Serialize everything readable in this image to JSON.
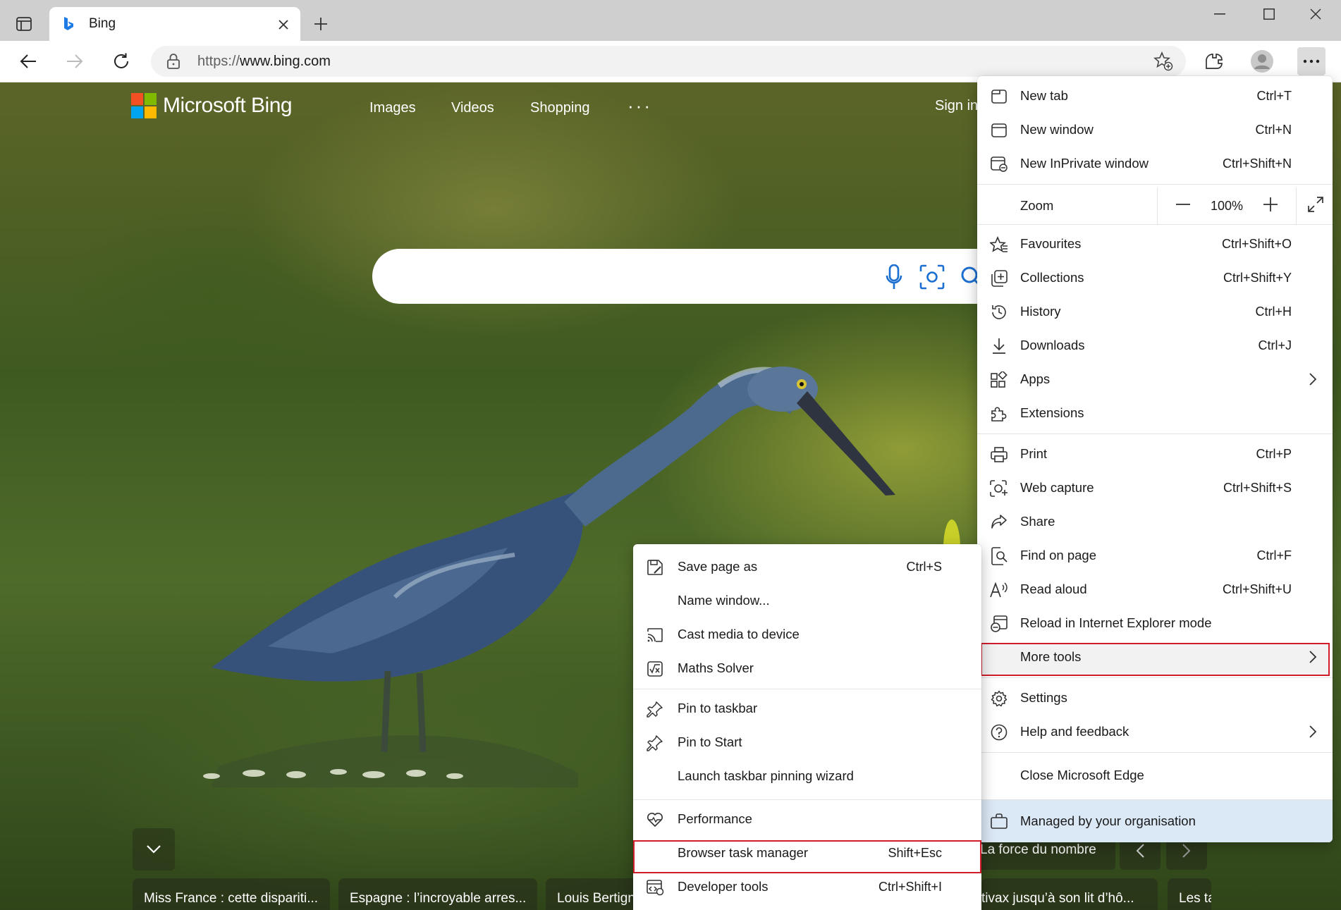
{
  "window": {
    "tab_title": "Bing",
    "controls": {
      "minimize_icon": "minimize-icon",
      "maximize_icon": "maximize-icon",
      "close_icon": "close-icon"
    }
  },
  "toolbar": {
    "url_scheme": "https://",
    "url_host": "www.bing.com"
  },
  "bing": {
    "logo_text": "Microsoft Bing",
    "nav": [
      "Images",
      "Videos",
      "Shopping"
    ],
    "more": "···",
    "sign_in": "Sign in",
    "logo_colors": [
      "#f25022",
      "#7fba00",
      "#00a4ef",
      "#ffb900"
    ],
    "news_cards": [
      "Miss France : cette dispariti...",
      "Espagne : l’incroyable arres...",
      "Louis Bertign",
      "tivax jusqu’à son lit d’hô...",
      "Les tali"
    ],
    "news_tag": "La force du nombre"
  },
  "main_menu": {
    "new_tab": {
      "label": "New tab",
      "shortcut": "Ctrl+T"
    },
    "new_window": {
      "label": "New window",
      "shortcut": "Ctrl+N"
    },
    "new_inprivate": {
      "label": "New InPrivate window",
      "shortcut": "Ctrl+Shift+N"
    },
    "zoom": {
      "label": "Zoom",
      "value": "100%"
    },
    "favourites": {
      "label": "Favourites",
      "shortcut": "Ctrl+Shift+O"
    },
    "collections": {
      "label": "Collections",
      "shortcut": "Ctrl+Shift+Y"
    },
    "history": {
      "label": "History",
      "shortcut": "Ctrl+H"
    },
    "downloads": {
      "label": "Downloads",
      "shortcut": "Ctrl+J"
    },
    "apps": {
      "label": "Apps"
    },
    "extensions": {
      "label": "Extensions"
    },
    "print": {
      "label": "Print",
      "shortcut": "Ctrl+P"
    },
    "web_capture": {
      "label": "Web capture",
      "shortcut": "Ctrl+Shift+S"
    },
    "share": {
      "label": "Share"
    },
    "find_on_page": {
      "label": "Find on page",
      "shortcut": "Ctrl+F"
    },
    "read_aloud": {
      "label": "Read aloud",
      "shortcut": "Ctrl+Shift+U"
    },
    "reload_ie": {
      "label": "Reload in Internet Explorer mode"
    },
    "more_tools": {
      "label": "More tools"
    },
    "settings": {
      "label": "Settings"
    },
    "help": {
      "label": "Help and feedback"
    },
    "close_edge": {
      "label": "Close Microsoft Edge"
    },
    "managed": {
      "label": "Managed by your organisation"
    }
  },
  "sub_menu": {
    "save_page": {
      "label": "Save page as",
      "shortcut": "Ctrl+S"
    },
    "name_window": {
      "label": "Name window..."
    },
    "cast": {
      "label": "Cast media to device"
    },
    "maths": {
      "label": "Maths Solver"
    },
    "pin_taskbar": {
      "label": "Pin to taskbar"
    },
    "pin_start": {
      "label": "Pin to Start"
    },
    "pin_wizard": {
      "label": "Launch taskbar pinning wizard"
    },
    "performance": {
      "label": "Performance"
    },
    "task_manager": {
      "label": "Browser task manager",
      "shortcut": "Shift+Esc"
    },
    "dev_tools": {
      "label": "Developer tools",
      "shortcut": "Ctrl+Shift+I"
    }
  },
  "colors": {
    "highlight_border": "#d11c2c",
    "managed_bg": "#dbe8f5",
    "tabstrip_bg": "#cfcfcf"
  }
}
